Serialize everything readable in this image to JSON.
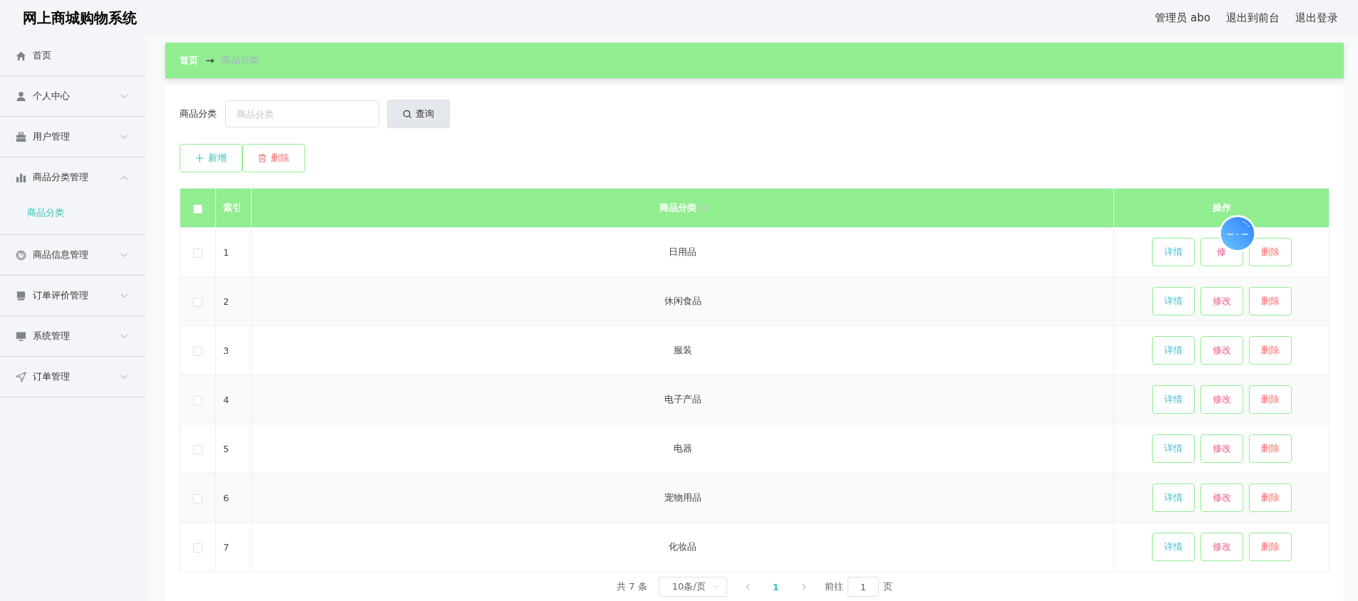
{
  "header": {
    "title": "网上商城购物系统",
    "links": [
      "管理员 abo",
      "退出到前台",
      "退出登录"
    ]
  },
  "sidebar": {
    "items": [
      {
        "label": "首页",
        "kind": "link"
      },
      {
        "label": "个人中心",
        "kind": "menu",
        "expanded": false
      },
      {
        "label": "用户管理",
        "kind": "menu",
        "expanded": false
      },
      {
        "label": "商品分类管理",
        "kind": "menu",
        "expanded": true,
        "children": [
          {
            "label": "商品分类",
            "selected": true
          }
        ]
      },
      {
        "label": "商品信息管理",
        "kind": "menu",
        "expanded": false
      },
      {
        "label": "订单评价管理",
        "kind": "menu",
        "expanded": false
      },
      {
        "label": "系统管理",
        "kind": "menu",
        "expanded": false
      },
      {
        "label": "订单管理",
        "kind": "menu",
        "expanded": false
      }
    ]
  },
  "breadcrumb": {
    "items": [
      "首页",
      "商品分类"
    ],
    "separator": "→"
  },
  "search": {
    "label": "商品分类",
    "placeholder": "商品分类",
    "button": "查询"
  },
  "actions": [
    {
      "label": "新增",
      "kind": "add"
    },
    {
      "label": "删除",
      "kind": "delete"
    }
  ],
  "table": {
    "all_checked": false,
    "columns": [
      {
        "label": "索引",
        "sortable": false
      },
      {
        "label": "商品分类",
        "sortable": true
      },
      {
        "label": "操作",
        "sortable": false
      }
    ],
    "rows": [
      {
        "index": "1",
        "name": "日用品",
        "checked": false,
        "actions": [
          "详情",
          "修",
          "删除"
        ]
      },
      {
        "index": "2",
        "name": "休闲食品",
        "checked": false,
        "actions": [
          "详情",
          "修改",
          "删除"
        ]
      },
      {
        "index": "3",
        "name": "服装",
        "checked": false,
        "actions": [
          "详情",
          "修改",
          "删除"
        ]
      },
      {
        "index": "4",
        "name": "电子产品",
        "checked": false,
        "actions": [
          "详情",
          "修改",
          "删除"
        ]
      },
      {
        "index": "5",
        "name": "电器",
        "checked": false,
        "actions": [
          "详情",
          "修改",
          "删除"
        ]
      },
      {
        "index": "6",
        "name": "宠物用品",
        "checked": false,
        "actions": [
          "详情",
          "修改",
          "删除"
        ]
      },
      {
        "index": "7",
        "name": "化妆品",
        "checked": false,
        "actions": [
          "详情",
          "修改",
          "删除"
        ]
      }
    ]
  },
  "pagination": {
    "total": "共 7 条",
    "page_size": "10条/页",
    "pages": [
      {
        "label": "1",
        "selected": true
      }
    ],
    "goto_label": "前往",
    "goto_value": "1",
    "page_suffix": "页"
  }
}
